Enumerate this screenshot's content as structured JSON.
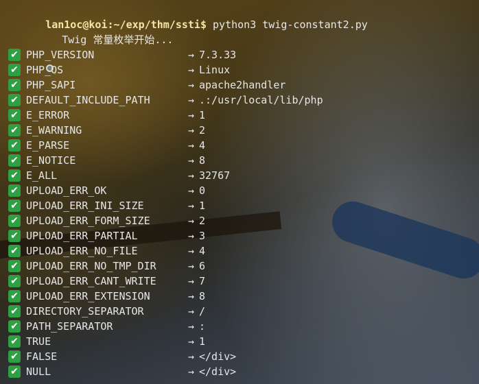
{
  "prompt": {
    "user_host": "lan1oc@koi",
    "path": ":~/exp/thm/ssti",
    "symbol": "$",
    "command": " python3 twig-constant2.py"
  },
  "status_line": {
    "icon": "search-icon",
    "text": "Twig 常量枚举开始..."
  },
  "results": [
    {
      "name": "PHP_VERSION",
      "value": "7.3.33"
    },
    {
      "name": "PHP_OS",
      "value": "Linux"
    },
    {
      "name": "PHP_SAPI",
      "value": "apache2handler"
    },
    {
      "name": "DEFAULT_INCLUDE_PATH",
      "value": ".:/usr/local/lib/php"
    },
    {
      "name": "E_ERROR",
      "value": "1"
    },
    {
      "name": "E_WARNING",
      "value": "2"
    },
    {
      "name": "E_PARSE",
      "value": "4"
    },
    {
      "name": "E_NOTICE",
      "value": "8"
    },
    {
      "name": "E_ALL",
      "value": "32767"
    },
    {
      "name": "UPLOAD_ERR_OK",
      "value": "0"
    },
    {
      "name": "UPLOAD_ERR_INI_SIZE",
      "value": "1"
    },
    {
      "name": "UPLOAD_ERR_FORM_SIZE",
      "value": "2"
    },
    {
      "name": "UPLOAD_ERR_PARTIAL",
      "value": "3"
    },
    {
      "name": "UPLOAD_ERR_NO_FILE",
      "value": "4"
    },
    {
      "name": "UPLOAD_ERR_NO_TMP_DIR",
      "value": "6"
    },
    {
      "name": "UPLOAD_ERR_CANT_WRITE",
      "value": "7"
    },
    {
      "name": "UPLOAD_ERR_EXTENSION",
      "value": "8"
    },
    {
      "name": "DIRECTORY_SEPARATOR",
      "value": "/"
    },
    {
      "name": "PATH_SEPARATOR",
      "value": ":"
    },
    {
      "name": "TRUE",
      "value": "1"
    },
    {
      "name": "FALSE",
      "value": "</div>"
    },
    {
      "name": "NULL",
      "value": "</div>"
    }
  ],
  "arrow": "→",
  "check_icon": "check-mark-icon",
  "colors": {
    "prompt": "#f5e6a8",
    "check_bg": "#2ea043",
    "text": "#e6e6e6"
  }
}
